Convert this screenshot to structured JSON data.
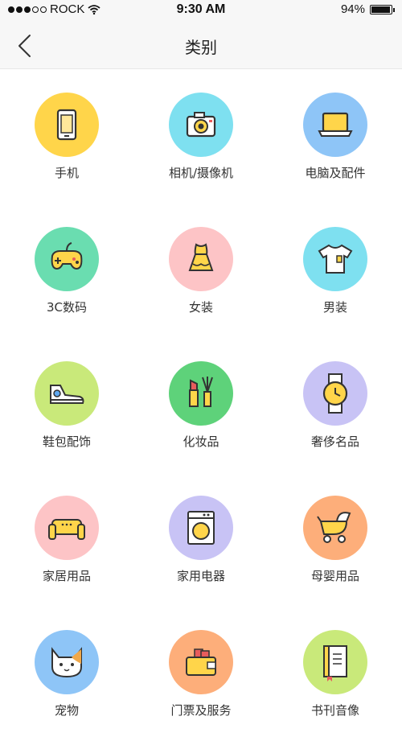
{
  "status": {
    "carrier": "ROCK",
    "time": "9:30 AM",
    "battery": "94%",
    "battery_level": 0.94
  },
  "nav": {
    "title": "类别"
  },
  "colors": {
    "yellow": "#FFD54A",
    "cyan": "#7EE0F0",
    "blue": "#8EC5F7",
    "green": "#6ADDB0",
    "pink": "#FDC4C6",
    "lime": "#C9E97A",
    "emerald": "#5ED27A",
    "lavender": "#C8C3F5",
    "orange": "#FDAE7A"
  },
  "categories": [
    {
      "label": "手机",
      "icon": "phone-icon",
      "color": "#FFD54A"
    },
    {
      "label": "相机/摄像机",
      "icon": "camera-icon",
      "color": "#7EE0F0"
    },
    {
      "label": "电脑及配件",
      "icon": "laptop-icon",
      "color": "#8EC5F7"
    },
    {
      "label": "3C数码",
      "icon": "gamepad-icon",
      "color": "#6ADDB0"
    },
    {
      "label": "女装",
      "icon": "dress-icon",
      "color": "#FDC4C6"
    },
    {
      "label": "男装",
      "icon": "shirt-icon",
      "color": "#7EE0F0"
    },
    {
      "label": "鞋包配饰",
      "icon": "sneaker-icon",
      "color": "#C9E97A"
    },
    {
      "label": "化妆品",
      "icon": "cosmetics-icon",
      "color": "#5ED27A"
    },
    {
      "label": "奢侈名品",
      "icon": "watch-icon",
      "color": "#C8C3F5"
    },
    {
      "label": "家居用品",
      "icon": "sofa-icon",
      "color": "#FDC4C6"
    },
    {
      "label": "家用电器",
      "icon": "washing-machine-icon",
      "color": "#C8C3F5"
    },
    {
      "label": "母婴用品",
      "icon": "stroller-icon",
      "color": "#FDAE7A"
    },
    {
      "label": "宠物",
      "icon": "cat-icon",
      "color": "#8EC5F7"
    },
    {
      "label": "门票及服务",
      "icon": "wallet-icon",
      "color": "#FDAE7A"
    },
    {
      "label": "书刊音像",
      "icon": "book-icon",
      "color": "#C9E97A"
    }
  ]
}
